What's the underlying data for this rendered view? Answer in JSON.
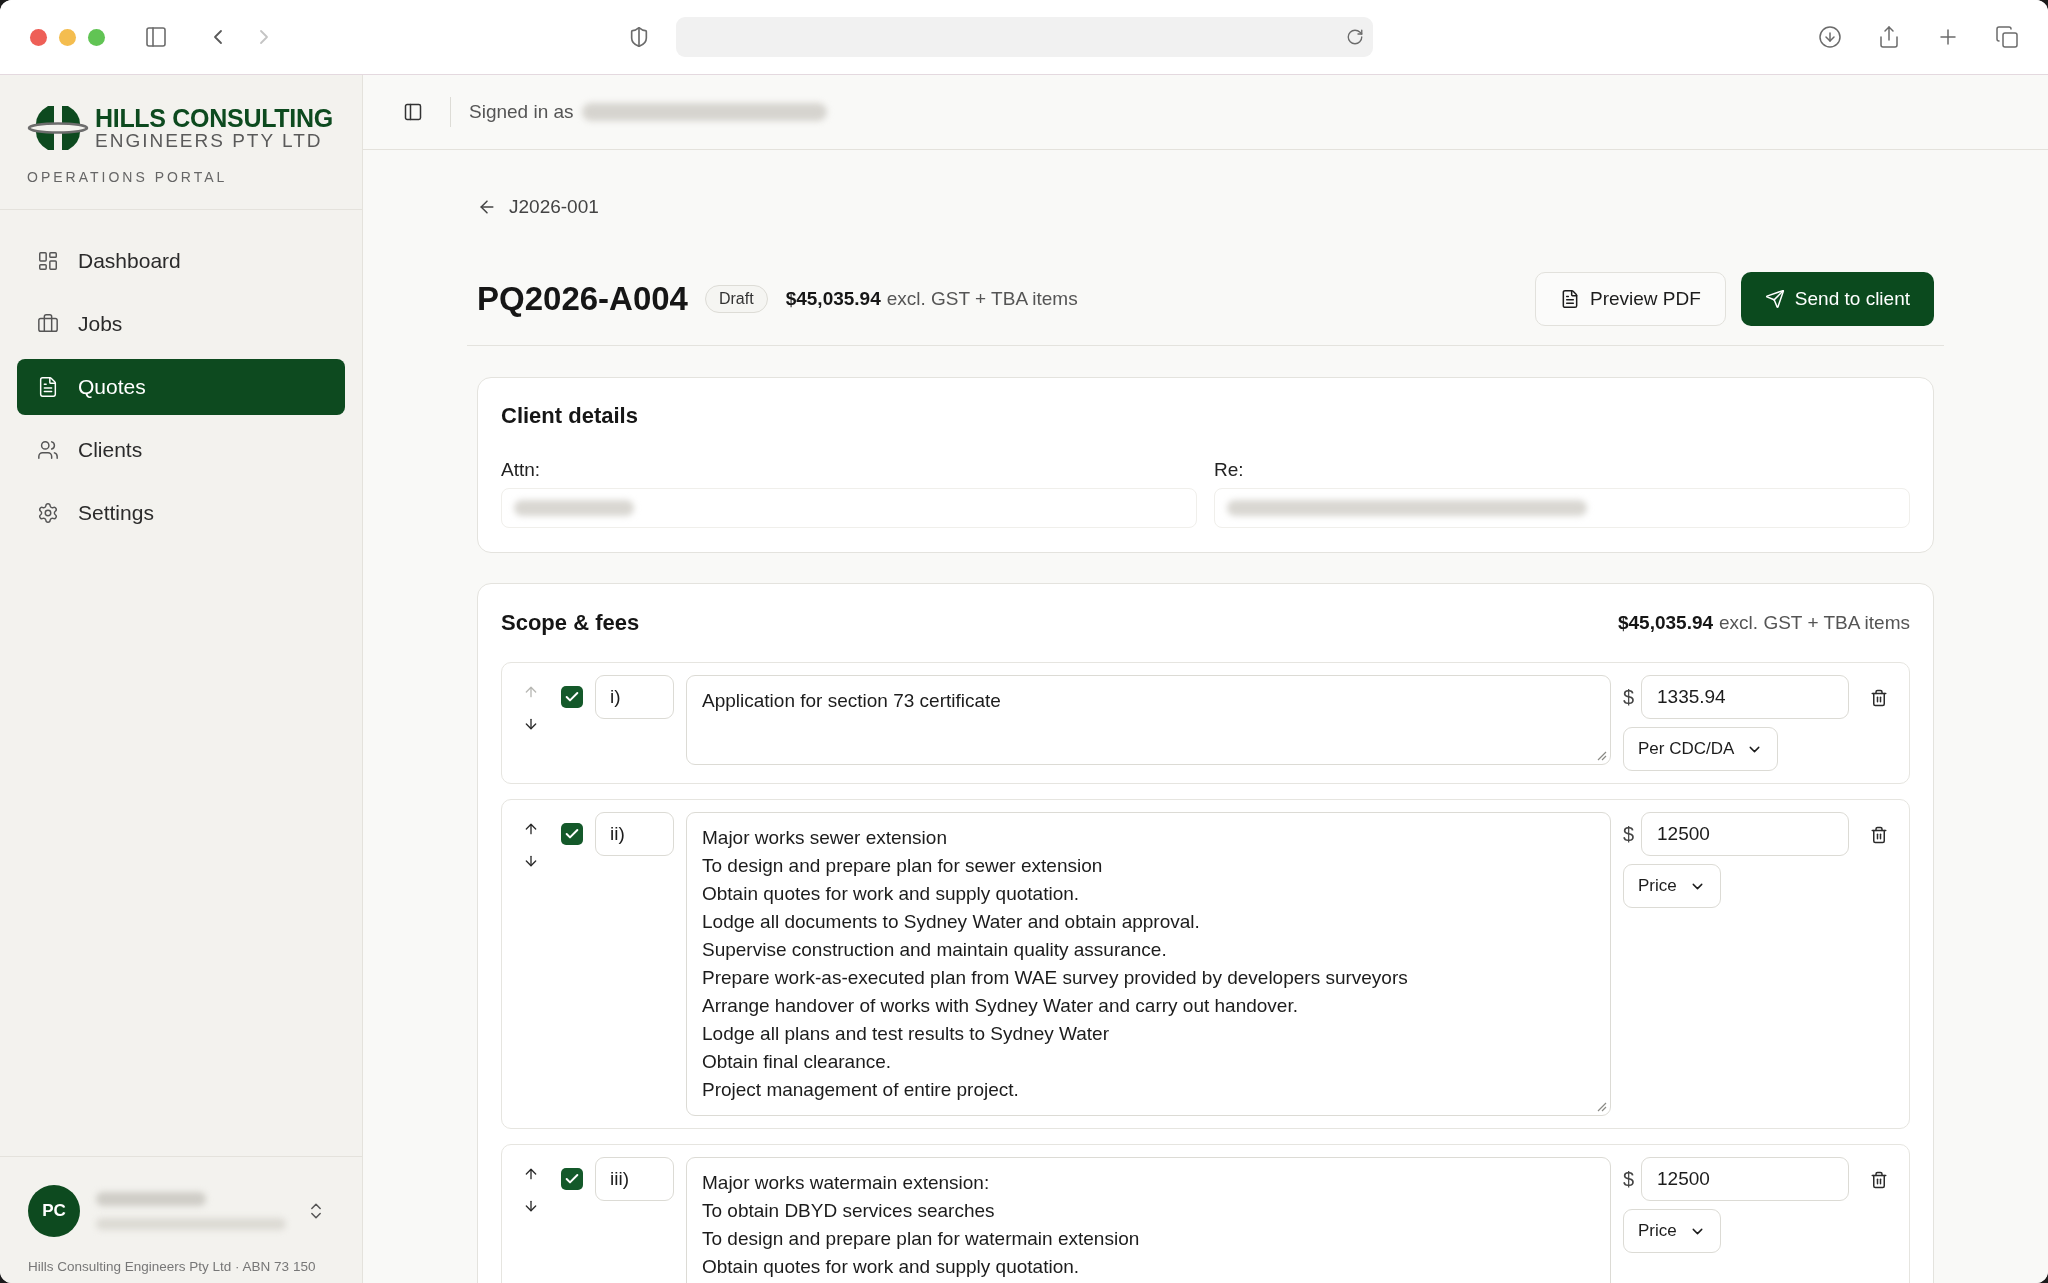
{
  "browser": {
    "back_disabled": false,
    "forward_disabled": true
  },
  "sidebar": {
    "brand": {
      "name": "HILLS CONSULTING",
      "subtitle": "ENGINEERS PTY LTD",
      "tagline": "OPERATIONS PORTAL"
    },
    "nav": [
      {
        "label": "Dashboard",
        "selected": false
      },
      {
        "label": "Jobs",
        "selected": false
      },
      {
        "label": "Quotes",
        "selected": true
      },
      {
        "label": "Clients",
        "selected": false
      },
      {
        "label": "Settings",
        "selected": false
      }
    ],
    "user": {
      "initials": "PC"
    },
    "footer": "Hills Consulting Engineers Pty Ltd · ABN 73 150"
  },
  "topbar": {
    "signed_in_label": "Signed in as"
  },
  "back_link": "J2026-001",
  "quote_header": {
    "number": "PQ2026-A004",
    "status": "Draft",
    "total": "$45,035.94",
    "total_note": "excl. GST + TBA items",
    "actions": [
      {
        "label": "Preview PDF",
        "kind": "secondary"
      },
      {
        "label": "Send to client",
        "kind": "primary"
      }
    ]
  },
  "client_details": {
    "title": "Client details",
    "fields": [
      {
        "label": "Attn:"
      },
      {
        "label": "Re:"
      }
    ]
  },
  "scope": {
    "title": "Scope & fees",
    "total": "$45,035.94",
    "total_note": "excl. GST + TBA items",
    "items": [
      {
        "checked": true,
        "move_up_disabled": true,
        "move_down_disabled": false,
        "number": "i)",
        "description": "Application for section 73 certificate",
        "currency": "$",
        "amount": "1335.94",
        "unit": "Per CDC/DA"
      },
      {
        "checked": true,
        "move_up_disabled": false,
        "move_down_disabled": false,
        "number": "ii)",
        "description": "Major works sewer extension\nTo design and prepare plan for sewer extension\nObtain quotes for work and supply quotation.\nLodge all documents to Sydney Water and obtain approval.\nSupervise construction and maintain quality assurance.\nPrepare work-as-executed plan from WAE survey provided by developers surveyors\nArrange handover of works with Sydney Water and carry out handover.\nLodge all plans and test results to Sydney Water\nObtain final clearance.\nProject management of entire project.",
        "currency": "$",
        "amount": "12500",
        "unit": "Price"
      },
      {
        "checked": true,
        "move_up_disabled": false,
        "move_down_disabled": false,
        "number": "iii)",
        "description": "Major works watermain extension:\nTo obtain DBYD services searches\nTo design and prepare plan for watermain extension\nObtain quotes for work and supply quotation.",
        "currency": "$",
        "amount": "12500",
        "unit": "Price"
      }
    ]
  }
}
